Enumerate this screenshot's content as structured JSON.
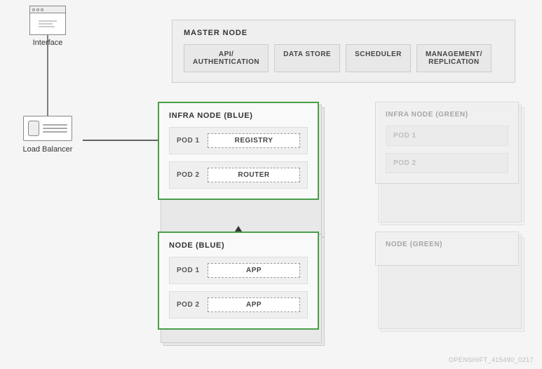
{
  "interface": {
    "label": "Interface"
  },
  "loadBalancer": {
    "label": "Load Balancer"
  },
  "masterNode": {
    "title": "MASTER NODE",
    "items": [
      {
        "label": "API/\nAUTHENTICATION"
      },
      {
        "label": "DATA STORE"
      },
      {
        "label": "SCHEDULER"
      },
      {
        "label": "MANAGEMENT/\nREPLICATION"
      }
    ]
  },
  "infraNodeBlue": {
    "title": "INFRA NODE (BLUE)",
    "pods": [
      {
        "pod": "POD 1",
        "component": "REGISTRY"
      },
      {
        "pod": "POD 2",
        "component": "ROUTER"
      }
    ]
  },
  "nodeBlue": {
    "title": "NODE (BLUE)",
    "pods": [
      {
        "pod": "POD 1",
        "component": "APP"
      },
      {
        "pod": "POD 2",
        "component": "APP"
      }
    ]
  },
  "infraNodeGreen": {
    "title": "INFRA NODE (GREEN)",
    "pods": [
      {
        "pod": "POD 1"
      },
      {
        "pod": "POD 2"
      }
    ]
  },
  "nodeGreen": {
    "title": "NODE (GREEN)"
  },
  "watermark": {
    "text": "OPENSHIFT_415490_0217"
  }
}
